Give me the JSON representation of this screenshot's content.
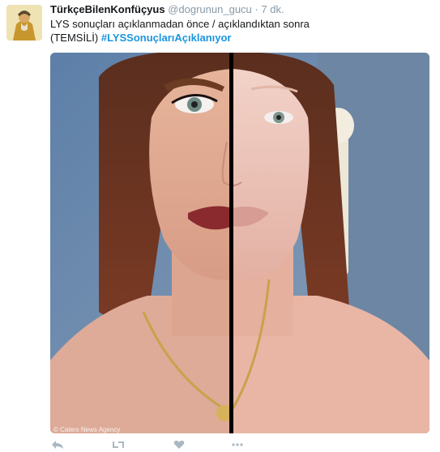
{
  "tweet": {
    "display_name": "TürkçeBilenKonfüçyus",
    "handle": "@dogrunun_gucu",
    "separator": "·",
    "time": "7 dk.",
    "text_line1": "LYS sonuçları açıklanmadan önce / açıklandıktan sonra",
    "text_line2_prefix": "(TEMSİLİ) ",
    "hashtag": "#LYSSonuçlarıAçıklanıyor",
    "media_watermark": "© Caters News Agency"
  },
  "actions": {
    "reply_icon": "reply-icon",
    "retweet_icon": "retweet-icon",
    "like_icon": "heart-icon",
    "more_icon": "more-icon"
  },
  "colors": {
    "hashtag": "#1b95e0",
    "meta": "#8899a6",
    "text": "#14171a"
  }
}
